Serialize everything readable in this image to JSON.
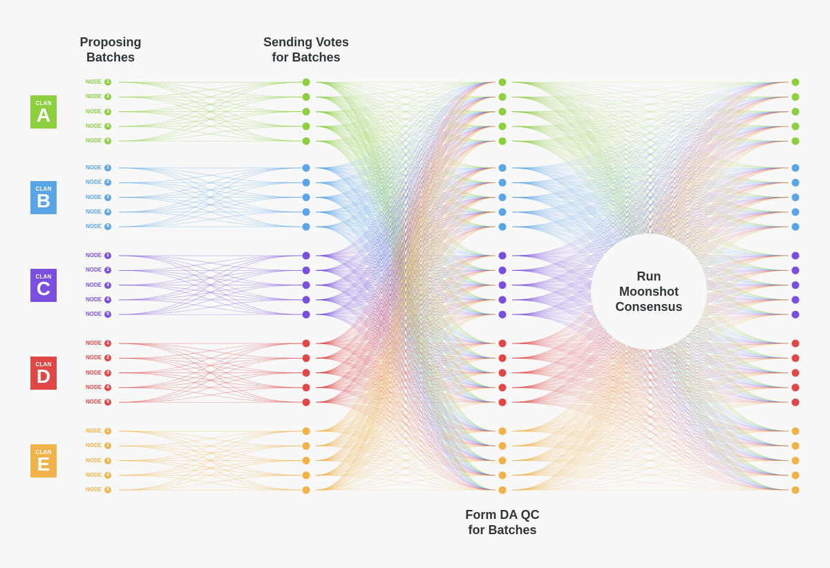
{
  "titles": {
    "proposing": "Proposing\nBatches",
    "sending_votes": "Sending Votes\nfor Batches",
    "form_da_qc": "Form DA QC\nfor Batches",
    "consensus": "Run\nMoonshot\nConsensus"
  },
  "clan_word": "CLAN",
  "node_word": "NODE",
  "clans": [
    {
      "letter": "A",
      "color": "#8ccf3f",
      "nodes": [
        "1",
        "2",
        "3",
        "4",
        "5"
      ]
    },
    {
      "letter": "B",
      "color": "#5aa5e8",
      "nodes": [
        "1",
        "2",
        "3",
        "4",
        "5"
      ]
    },
    {
      "letter": "C",
      "color": "#7a4fe0",
      "nodes": [
        "1",
        "2",
        "3",
        "4",
        "5"
      ]
    },
    {
      "letter": "D",
      "color": "#e04848",
      "nodes": [
        "1",
        "2",
        "3",
        "4",
        "5"
      ]
    },
    {
      "letter": "E",
      "color": "#f2b24a",
      "nodes": [
        "1",
        "2",
        "3",
        "4",
        "5"
      ]
    }
  ],
  "stages": [
    "Proposing Batches",
    "Sending Votes for Batches",
    "Form DA QC for Batches",
    "Run Moonshot Consensus"
  ]
}
